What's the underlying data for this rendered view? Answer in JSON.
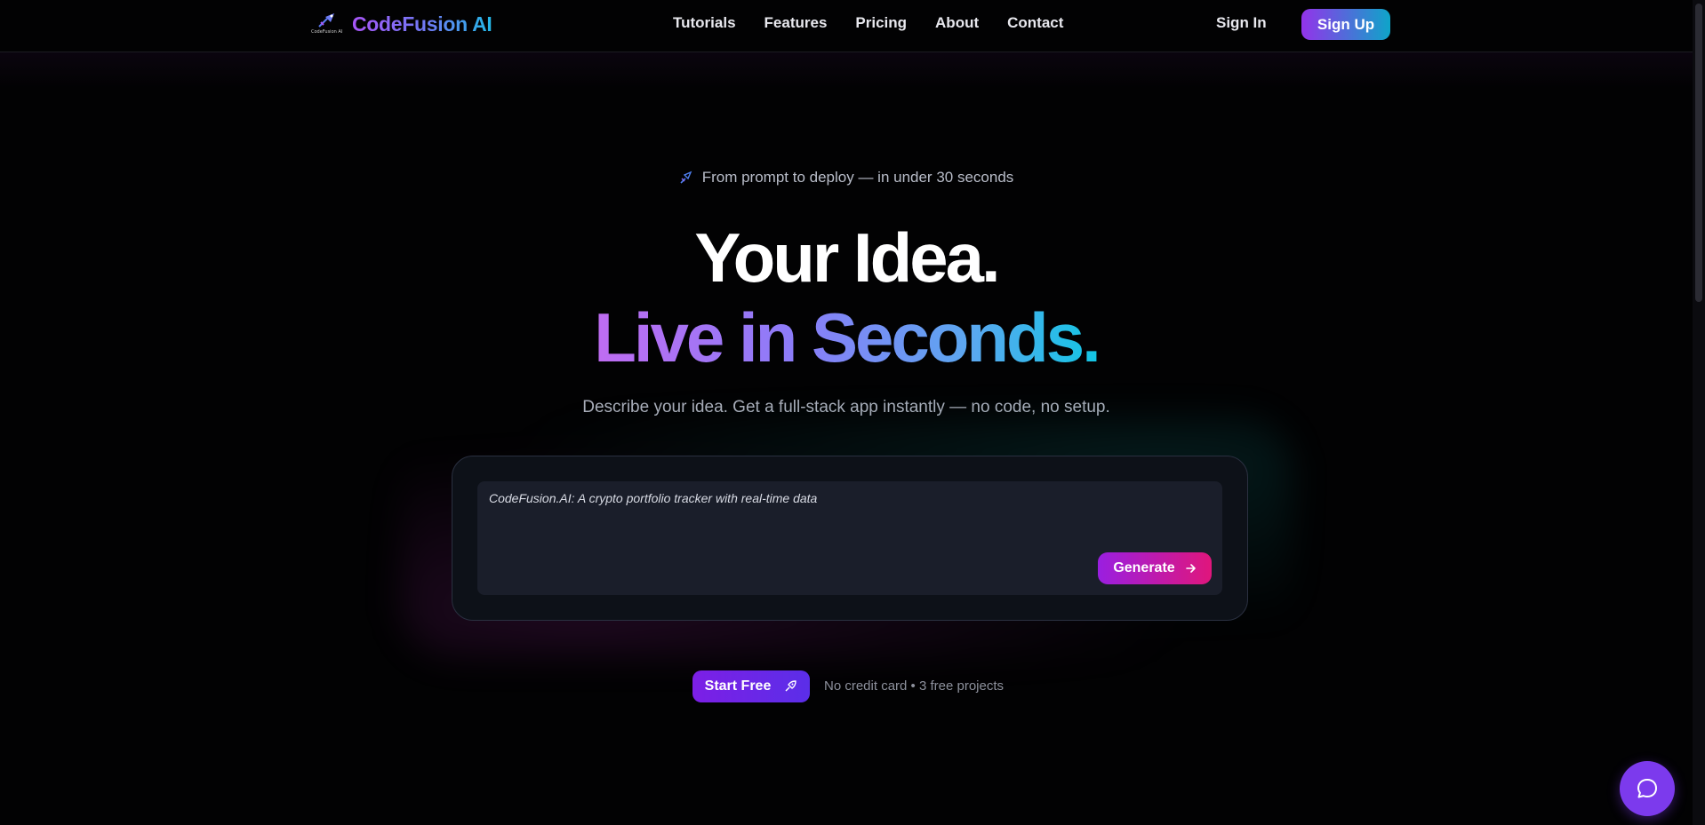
{
  "brand": {
    "name": "CodeFusion AI",
    "mark_caption": "CodeFusion AI",
    "accent_colors": [
      "#a855f7",
      "#22b8e6"
    ]
  },
  "nav": {
    "links": [
      {
        "label": "Tutorials"
      },
      {
        "label": "Features"
      },
      {
        "label": "Pricing"
      },
      {
        "label": "About"
      },
      {
        "label": "Contact"
      }
    ],
    "sign_in": "Sign In",
    "sign_up": "Sign Up"
  },
  "hero": {
    "tagline_icon": "rocket-icon",
    "tagline": "From prompt to deploy — in under 30 seconds",
    "line1": "Your Idea.",
    "line2": "Live in Seconds.",
    "subtitle": "Describe your idea. Get a full-stack app instantly — no code, no setup."
  },
  "prompt": {
    "value": "CodeFusion.AI: A crypto portfolio tracker with real-time data",
    "generate_label": "Generate",
    "generate_icon": "arrow-right-icon"
  },
  "cta": {
    "start_free": "Start Free",
    "start_icon": "rocket-icon",
    "note": "No credit card • 3 free projects"
  },
  "chat": {
    "icon": "chat-bubble-icon"
  }
}
